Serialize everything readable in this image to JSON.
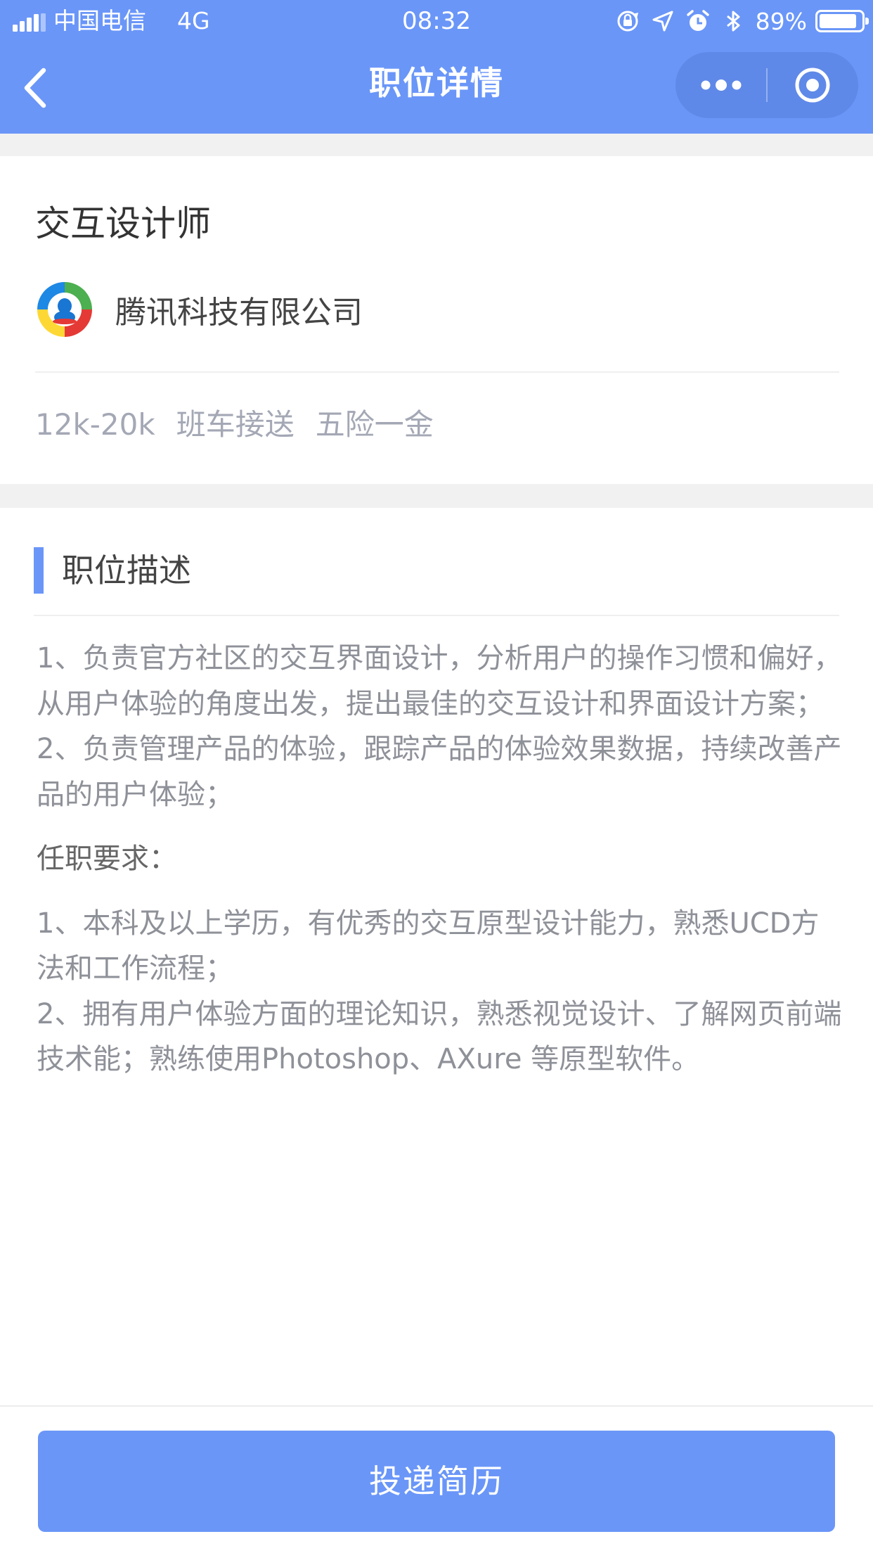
{
  "status_bar": {
    "carrier": "中国电信",
    "network": "4G",
    "time": "08:32",
    "battery_percent": "89%",
    "battery_level": 0.89,
    "icons": [
      "signal-icon",
      "lock-rotation-icon",
      "location-icon",
      "alarm-icon",
      "bluetooth-icon",
      "battery-icon"
    ]
  },
  "nav": {
    "title": "职位详情",
    "back_icon": "chevron-left-icon",
    "more_icon": "more-dots-icon",
    "close_icon": "target-close-icon"
  },
  "job": {
    "title": "交互设计师",
    "company": "腾讯科技有限公司",
    "tags": [
      "12k-20k",
      "班车接送",
      "五险一金"
    ]
  },
  "description": {
    "section_title": "职位描述",
    "duties": [
      "1、负责官方社区的交互界面设计，分析用户的操作习惯和偏好，从用户体验的角度出发，提出最佳的交互设计和界面设计方案；",
      "2、负责管理产品的体验，跟踪产品的体验效果数据，持续改善产品的用户体验；"
    ],
    "requirements_title": "任职要求：",
    "requirements": [
      "1、本科及以上学历，有优秀的交互原型设计能力，熟悉UCD方法和工作流程；",
      "2、拥有用户体验方面的理论知识，熟悉视觉设计、了解网页前端技术能；熟练使用Photoshop、AXure 等原型软件。"
    ]
  },
  "actions": {
    "apply_label": "投递简历"
  },
  "colors": {
    "accent": "#6a96f8",
    "tag_text": "#a4a8b5",
    "body_text": "#8f9199",
    "background_gap": "#f1f1f2"
  }
}
